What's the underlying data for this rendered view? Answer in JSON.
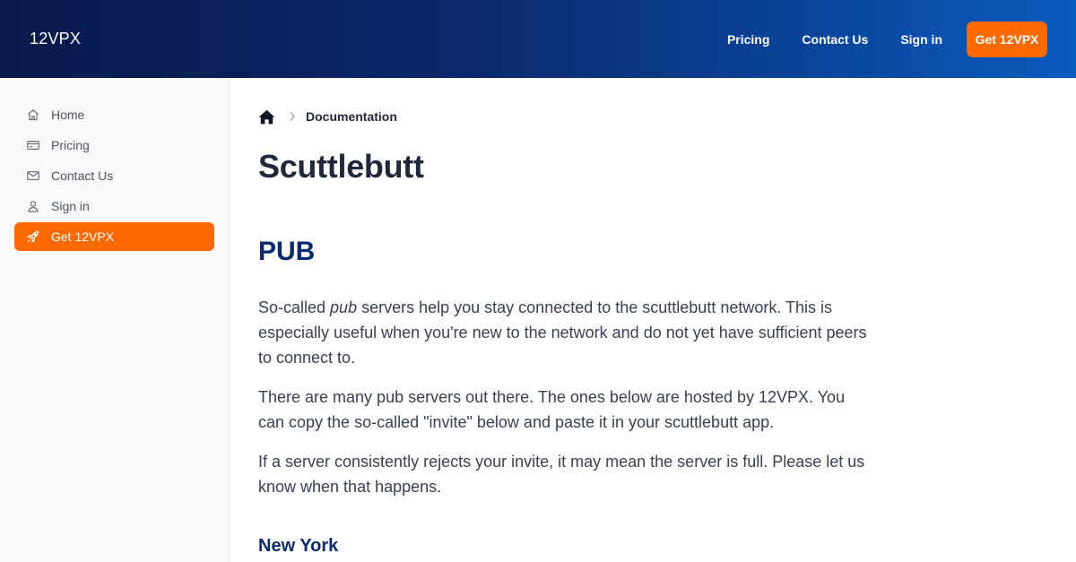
{
  "header": {
    "logo": "12VPX",
    "nav": [
      "Pricing",
      "Contact Us",
      "Sign in"
    ],
    "cta_label": "Get 12VPX"
  },
  "sidebar": {
    "items": [
      {
        "label": "Home",
        "icon": "home-icon"
      },
      {
        "label": "Pricing",
        "icon": "credit-card-icon"
      },
      {
        "label": "Contact Us",
        "icon": "envelope-icon"
      },
      {
        "label": "Sign in",
        "icon": "user-icon"
      },
      {
        "label": "Get 12VPX",
        "icon": "rocket-icon",
        "active": true
      }
    ]
  },
  "breadcrumb": {
    "current": "Documentation"
  },
  "page": {
    "title": "Scuttlebutt",
    "section_title": "PUB",
    "p1_prefix": "So-called ",
    "p1_em": "pub",
    "p1_suffix": " servers help you stay connected to the scuttlebutt network. This is especially useful when you're new to the network and do not yet have sufficient peers to connect to.",
    "p2": "There are many pub servers out there. The ones below are hosted by 12VPX. You can copy the so-called \"invite\" below and paste it in your scuttlebutt app.",
    "p3": "If a server consistently rejects your invite, it may mean the server is full. Please let us know when that happens.",
    "subsection_title": "New York"
  },
  "colors": {
    "accent": "#ff6a00",
    "heading_blue": "#0b2a6e",
    "header_gradient_start": "#0a1a4a",
    "header_gradient_end": "#0a5bbf"
  }
}
